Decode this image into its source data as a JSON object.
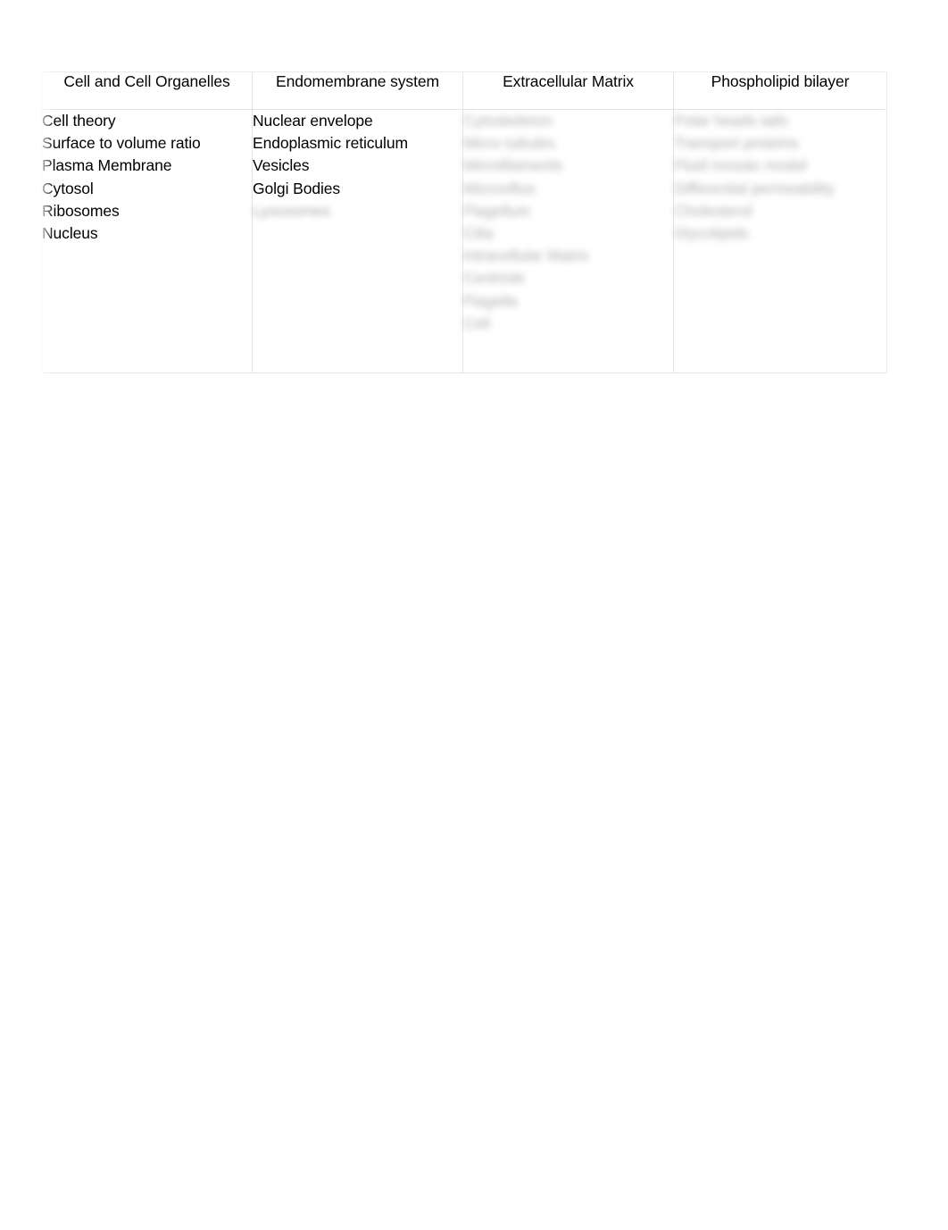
{
  "document": {
    "background_color": "#ffffff",
    "table_border_color": "#e3e3e3",
    "text_color": "#000000",
    "redacted_text_color": "#8d8d8d"
  },
  "table": {
    "columns": [
      {
        "header": "Cell and Cell Organelles",
        "redacted": false,
        "items": [
          {
            "text": "Cell theory",
            "redacted": false
          },
          {
            "text": "Surface to volume ratio",
            "redacted": false
          },
          {
            "text": "Plasma Membrane",
            "redacted": false
          },
          {
            "text": "Cytosol",
            "redacted": false
          },
          {
            "text": "Ribosomes",
            "redacted": false
          },
          {
            "text": "Nucleus",
            "redacted": false
          }
        ]
      },
      {
        "header": "Endomembrane system",
        "redacted": false,
        "items": [
          {
            "text": "Nuclear envelope",
            "redacted": false
          },
          {
            "text": "Endoplasmic reticulum",
            "redacted": false
          },
          {
            "text": "Vesicles",
            "redacted": false
          },
          {
            "text": "Golgi Bodies",
            "redacted": false
          },
          {
            "text": "Lysosomes",
            "redacted": true
          }
        ]
      },
      {
        "header": "Extracellular Matrix",
        "redacted": true,
        "items": [
          {
            "text": "Cytoskeleton",
            "redacted": true
          },
          {
            "text": "Micro  tubules",
            "redacted": true
          },
          {
            "text": "Microfilaments",
            "redacted": true
          },
          {
            "text": "Microvillus",
            "redacted": true
          },
          {
            "text": "Flagellum",
            "redacted": true
          },
          {
            "text": "Cilia",
            "redacted": true
          },
          {
            "text": "Intracellular Matrix",
            "redacted": true
          },
          {
            "text": "Centriole",
            "redacted": true
          },
          {
            "text": "Flagella",
            "redacted": true
          },
          {
            "text": "Cell",
            "redacted": true
          }
        ]
      },
      {
        "header": "Phospholipid bilayer",
        "redacted": true,
        "items": [
          {
            "text": "Polar heads   tails",
            "redacted": true
          },
          {
            "text": "Transport proteins",
            "redacted": true
          },
          {
            "text": "Fluid mosaic model",
            "redacted": true
          },
          {
            "text": "Differential permeability",
            "redacted": true
          },
          {
            "text": "Cholesterol",
            "redacted": true
          },
          {
            "text": "Glycolipids",
            "redacted": true
          }
        ]
      }
    ]
  }
}
